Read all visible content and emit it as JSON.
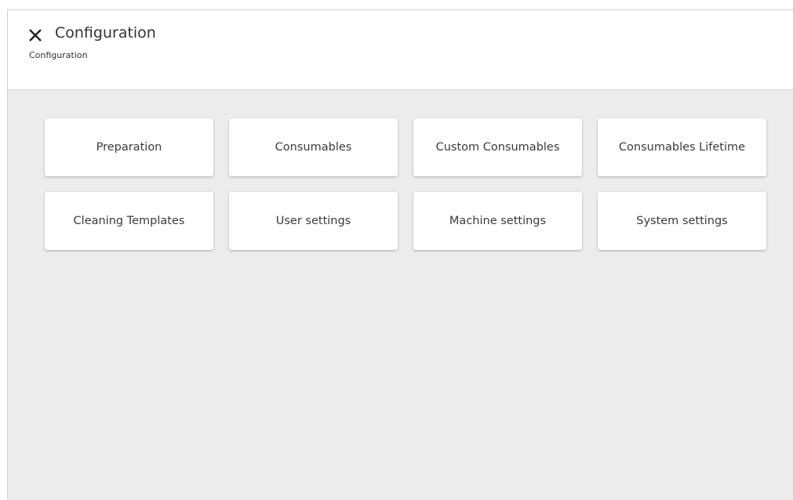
{
  "header": {
    "title": "Configuration",
    "breadcrumb": "Configuration",
    "close_icon": "close-icon"
  },
  "tiles": [
    {
      "label": "Preparation"
    },
    {
      "label": "Consumables"
    },
    {
      "label": "Custom Consumables"
    },
    {
      "label": "Consumables Lifetime"
    },
    {
      "label": "Cleaning Templates"
    },
    {
      "label": "User settings"
    },
    {
      "label": "Machine settings"
    },
    {
      "label": "System settings"
    }
  ],
  "colors": {
    "content_background": "#ececec",
    "tile_background": "#ffffff",
    "text": "#333333"
  }
}
